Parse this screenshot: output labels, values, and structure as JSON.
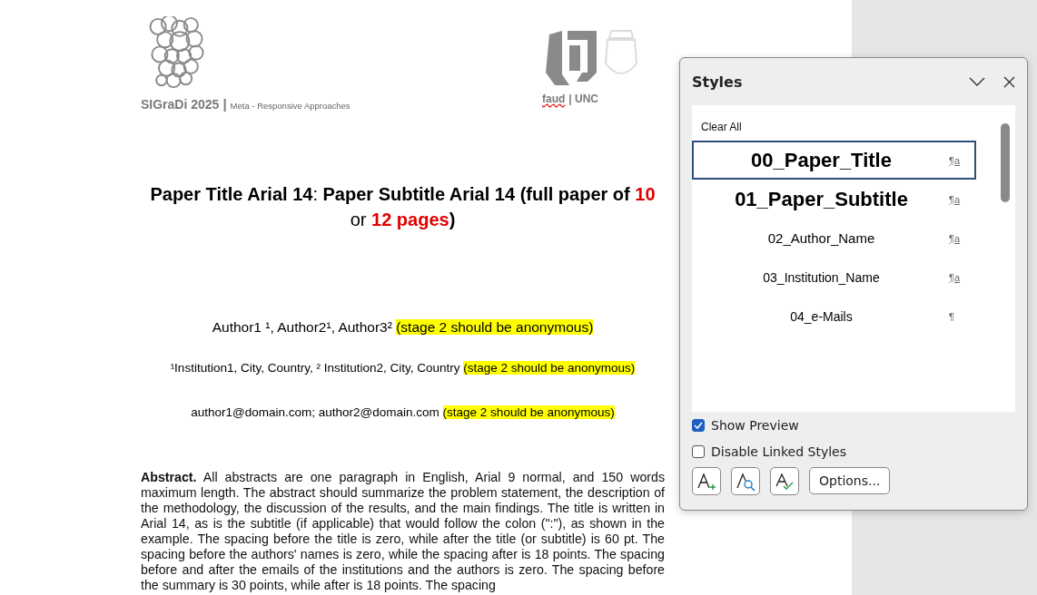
{
  "document": {
    "header": {
      "conference": "SIGraDi 2025",
      "separator": "|",
      "theme": "Meta - Responsive Approaches",
      "faculty": "faud",
      "faculty_separator": "| UNC"
    },
    "title": [
      {
        "text": "Paper Title Arial 14",
        "bold": true,
        "color": "#000000"
      },
      {
        "text": ": ",
        "bold": false,
        "color": "#000000"
      },
      {
        "text": "Paper Subtitle Arial 14 (full paper of ",
        "bold": true,
        "color": "#000000"
      },
      {
        "text": "10",
        "bold": true,
        "color": "#e00000"
      },
      {
        "text": " or ",
        "bold": false,
        "color": "#000000"
      },
      {
        "text": "12 pages",
        "bold": true,
        "color": "#e00000"
      },
      {
        "text": ")",
        "bold": true,
        "color": "#000000"
      }
    ],
    "authors": [
      {
        "text": "Author1 ¹, Author2¹, Author3² ",
        "highlight": false
      },
      {
        "text": "(stage 2 should be anonymous)",
        "highlight": true
      }
    ],
    "institutions": [
      {
        "text": "¹Institution1, City, Country, ² Institution2, City, Country ",
        "highlight": false
      },
      {
        "text": "(stage 2 should be anonymous)",
        "highlight": true
      }
    ],
    "emails": [
      {
        "text": "author1@domain.com; author2@domain.com ",
        "highlight": false
      },
      {
        "text": "(stage 2 should be anonymous)",
        "highlight": true
      }
    ],
    "abstract": "**Abstract.** All abstracts are one paragraph in English, Arial 9 normal, and 150 words maximum length. The abstract should summarize the problem statement, the description of the methodology, the discussion of the results, and the main findings. The title is written in Arial 14, as is the subtitle (if applicable) that would follow the colon (\":\"), as shown in the example. The spacing before the title is zero, while after the title (or subtitle) is 60 pt. The spacing before the authors' names is zero, while the spacing after is 18 points. The spacing before and after the emails of the institutions and the authors is zero. The spacing before the summary is 30 points, while after is 18 points. The spacing"
  },
  "styles_pane": {
    "title": "Styles",
    "clear_all": "Clear All",
    "items": [
      {
        "name": "00_Paper_Title",
        "kind": "heading",
        "mark": "¶a",
        "selected": true
      },
      {
        "name": "01_Paper_Subtitle",
        "kind": "heading",
        "mark": "¶a",
        "selected": false
      },
      {
        "name": "02_Author_Name",
        "kind": "normal",
        "mark": "¶a",
        "selected": false
      },
      {
        "name": "03_Institution_Name",
        "kind": "small",
        "mark": "¶a",
        "selected": false
      },
      {
        "name": "04_e-Mails",
        "kind": "small",
        "mark": "¶",
        "selected": false
      }
    ],
    "options": [
      {
        "label": "Show Preview",
        "checked": true
      },
      {
        "label": "Disable Linked Styles",
        "checked": false
      }
    ],
    "options_button": "Options..."
  }
}
